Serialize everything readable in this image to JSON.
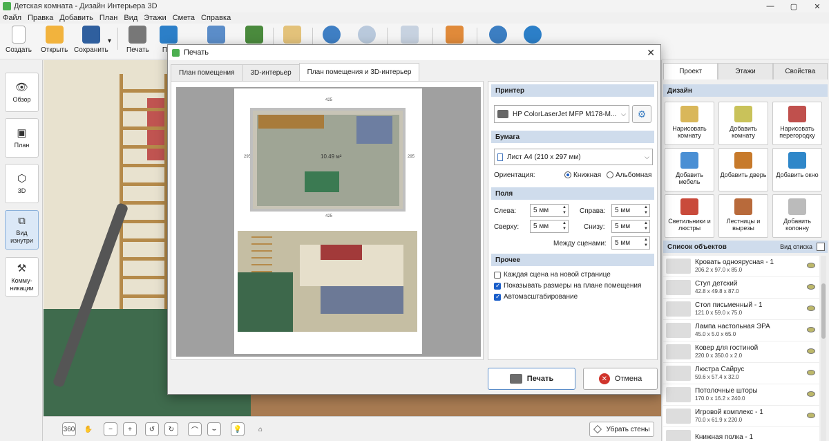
{
  "window": {
    "title": "Детская комната - Дизайн Интерьера 3D",
    "min": "—",
    "max": "▢",
    "close": "✕"
  },
  "menu": [
    "Файл",
    "Правка",
    "Добавить",
    "План",
    "Вид",
    "Этажи",
    "Смета",
    "Справка"
  ],
  "toolbar": {
    "create": "Создать",
    "open": "Открыть",
    "save": "Сохранить",
    "print": "Печать",
    "preview_cut": "Пре"
  },
  "left": {
    "overview": "Обзор",
    "plan": "План",
    "threed": "3D",
    "inside": "Вид изнутри",
    "comm": "Комму-никации"
  },
  "bottom": {
    "remove_walls": "Убрать стены",
    "rotate": "360"
  },
  "colors": {
    "accent": "#1a5ec9",
    "header": "#cfdcec"
  },
  "right": {
    "tabs": [
      "Проект",
      "Этажи",
      "Свойства"
    ],
    "design": "Дизайн",
    "cards": [
      "Нарисовать комнату",
      "Добавить комнату",
      "Нарисовать перегородку",
      "Добавить мебель",
      "Добавить дверь",
      "Добавить окно",
      "Светильники и люстры",
      "Лестницы и вырезы",
      "Добавить колонну"
    ],
    "objects_title": "Список объектов",
    "view_list": "Вид списка",
    "objects": [
      {
        "name": "Кровать одноярусная - 1",
        "dim": "206.2 x 97.0 x 85.0"
      },
      {
        "name": "Стул детский",
        "dim": "42.8 x 49.8 x 87.0"
      },
      {
        "name": "Стол письменный - 1",
        "dim": "121.0 x 59.0 x 75.0"
      },
      {
        "name": "Лампа настольная ЭРА",
        "dim": "45.0 x 5.0 x 65.0"
      },
      {
        "name": "Ковер для гостиной",
        "dim": "220.0 x 350.0 x 2.0"
      },
      {
        "name": "Люстра Сайрус",
        "dim": "59.6 x 57.4 x 32.0"
      },
      {
        "name": "Потолочные шторы",
        "dim": "170.0 x 16.2 x 240.0"
      },
      {
        "name": "Игровой комплекс - 1",
        "dim": "70.0 x 61.9 x 220.0"
      },
      {
        "name": "Книжная полка - 1",
        "dim": ""
      }
    ]
  },
  "dialog": {
    "title": "Печать",
    "tabs": [
      "План помещения",
      "3D-интерьер",
      "План помещения и 3D-интерьер"
    ],
    "preview": {
      "dim_top": "425",
      "dim_bottom": "425",
      "dim_left": "295",
      "dim_right": "295",
      "area": "10.49 м²"
    },
    "printer_hdr": "Принтер",
    "printer": "HP ColorLaserJet MFP M178-M...",
    "paper_hdr": "Бумага",
    "paper": "Лист A4 (210 x 297 мм)",
    "orientation_label": "Ориентация:",
    "portrait": "Книжная",
    "landscape": "Альбомная",
    "margins_hdr": "Поля",
    "left_label": "Слева:",
    "left_val": "5 мм",
    "right_label": "Справа:",
    "right_val": "5 мм",
    "top_label": "Сверху:",
    "top_val": "5 мм",
    "bottom_label": "Снизу:",
    "bottom_val": "5 мм",
    "between_label": "Между сценами:",
    "between_val": "5 мм",
    "other_hdr": "Прочее",
    "opt1": "Каждая сцена на новой странице",
    "opt2": "Показывать размеры на плане помещения",
    "opt3": "Автомасштабирование",
    "print_btn": "Печать",
    "cancel_btn": "Отмена"
  }
}
